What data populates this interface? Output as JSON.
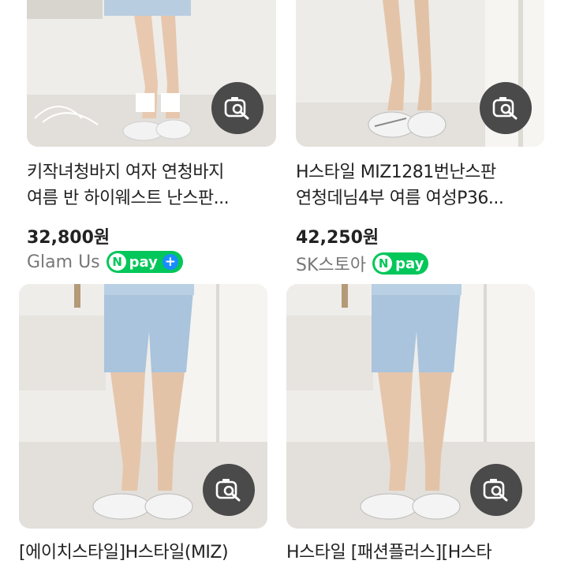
{
  "products": [
    {
      "title_line1": "키작녀청바지 여자 연청바지",
      "title_line2": "여름 반 하이웨스트 난스판...",
      "price": "32,800원",
      "seller": "Glam Us",
      "npay_label": "pay",
      "npay_plus": "+",
      "icon": "image-search-icon"
    },
    {
      "title_line1": "H스타일 MIZ1281번난스판",
      "title_line2": "연청데님4부 여름 여성P36...",
      "price": "42,250원",
      "seller": "SK스토아",
      "npay_label": "pay",
      "icon": "image-search-icon"
    },
    {
      "title_line1": "[에이치스타일]H스타일(MIZ)",
      "icon": "image-search-icon"
    },
    {
      "title_line1": "H스타일 [패션플러스][H스타",
      "icon": "image-search-icon"
    }
  ],
  "colors": {
    "npay_green": "#03c75a",
    "plus_blue": "#1a8cff",
    "lens_bg": "#4a4a4a"
  }
}
